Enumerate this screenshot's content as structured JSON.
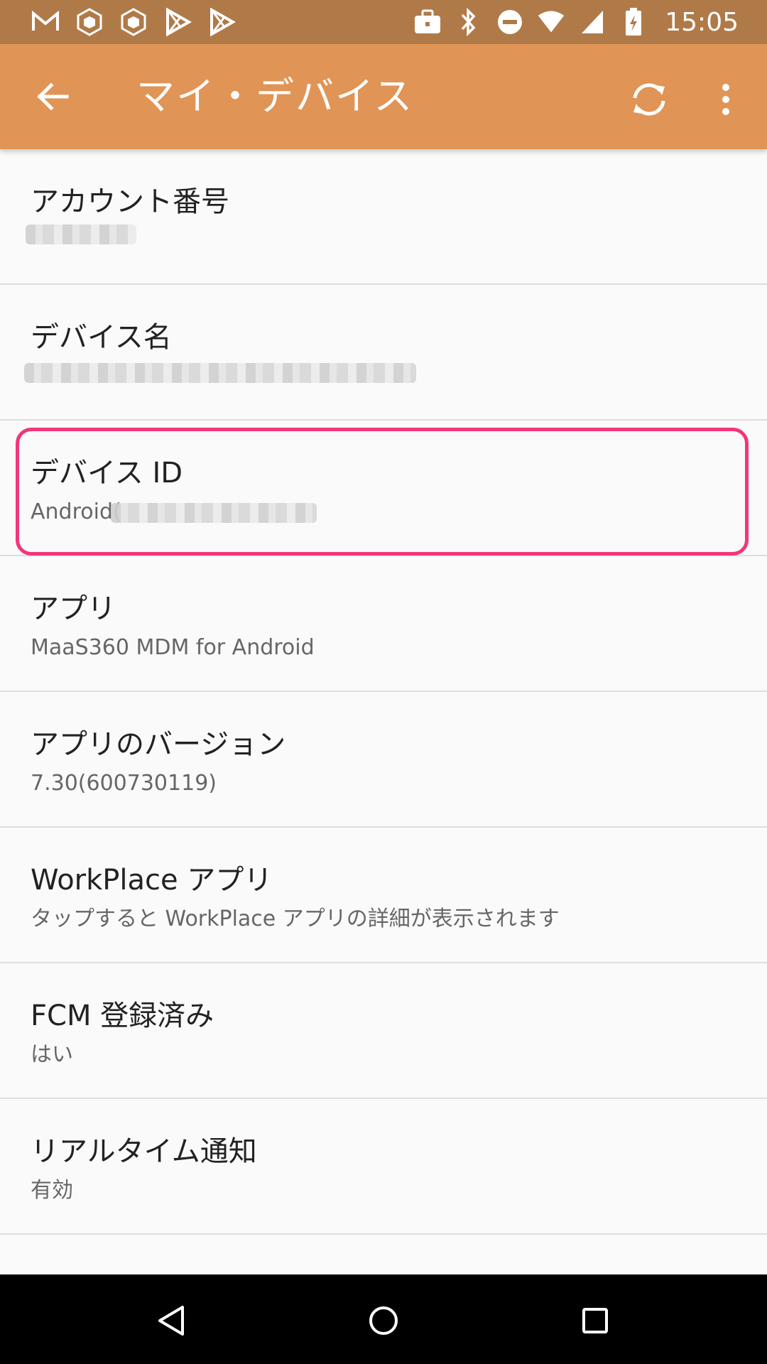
{
  "status_bar": {
    "time": "15:05",
    "left_icons": [
      "mail-icon",
      "hex-app-icon",
      "hex-app-icon",
      "play-store-icon",
      "play-store-icon"
    ],
    "right_icons": [
      "briefcase-icon",
      "bluetooth-icon",
      "do-not-disturb-icon",
      "wifi-icon",
      "signal-icon",
      "battery-charging-icon"
    ]
  },
  "app_bar": {
    "title": "マイ・デバイス",
    "color": "#e09456"
  },
  "rows": [
    {
      "title": "アカウント番号",
      "subtitle": ""
    },
    {
      "title": "デバイス名",
      "subtitle": ""
    },
    {
      "title": "デバイス ID",
      "subtitle": "Android("
    },
    {
      "title": "アプリ",
      "subtitle": "MaaS360 MDM for Android"
    },
    {
      "title": "アプリのバージョン",
      "subtitle": "7.30(600730119)"
    },
    {
      "title": "WorkPlace アプリ",
      "subtitle": "タップすると WorkPlace アプリの詳細が表示されます"
    },
    {
      "title": "FCM 登録済み",
      "subtitle": "はい"
    },
    {
      "title": "リアルタイム通知",
      "subtitle": "有効"
    }
  ],
  "highlight_color": "#f2367a"
}
